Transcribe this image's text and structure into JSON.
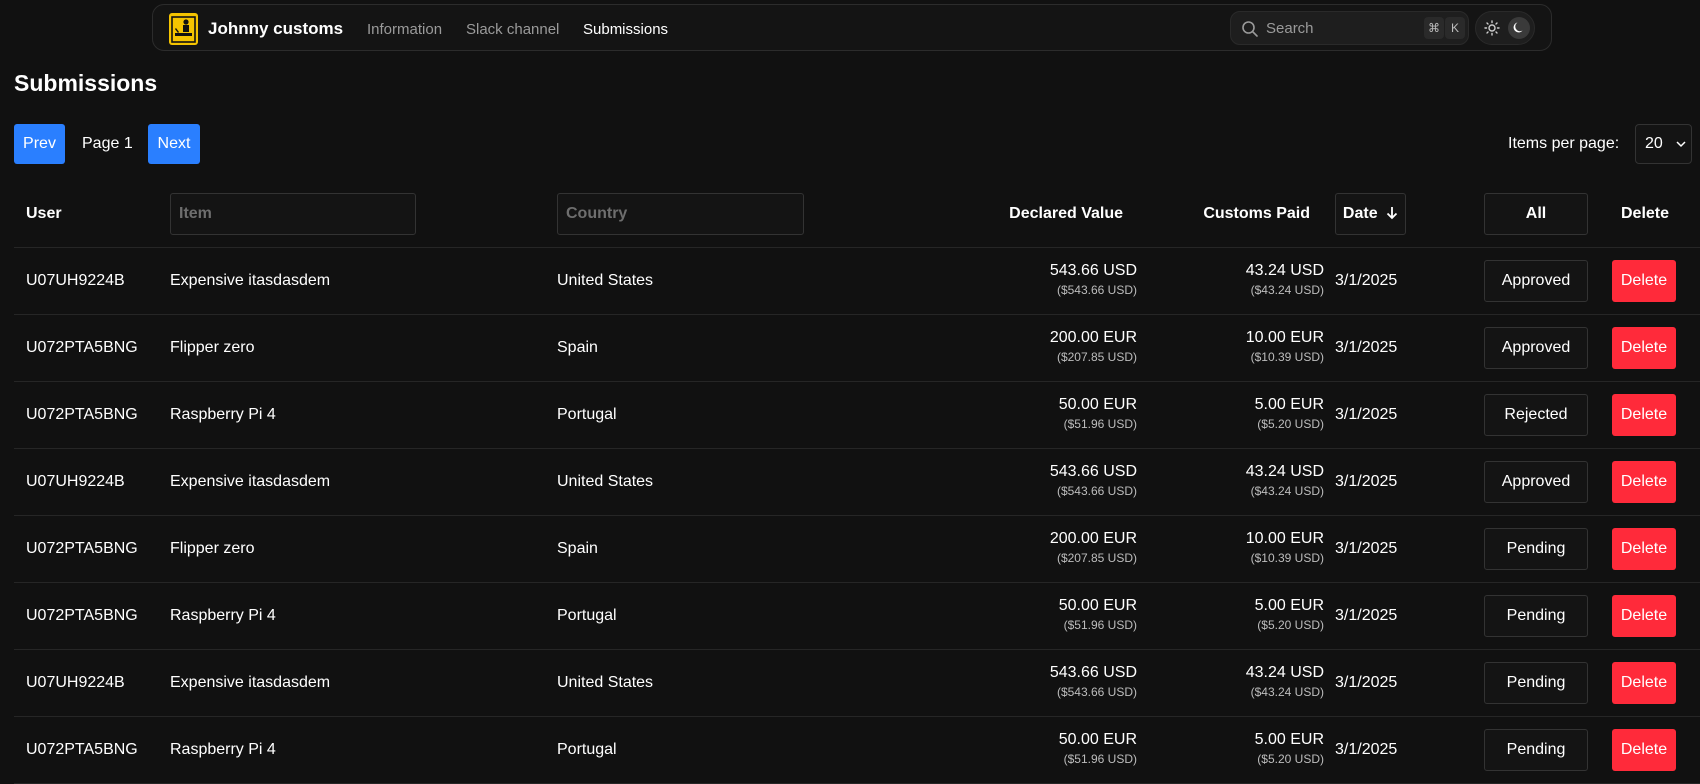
{
  "nav": {
    "brand": "Johnny customs",
    "links": [
      "Information",
      "Slack channel",
      "Submissions"
    ],
    "active_index": 2,
    "search_placeholder": "Search",
    "kbd_cmd": "⌘",
    "kbd_k": "K",
    "logo_icon": "customs-officer-logo",
    "theme_options": [
      "light",
      "dark"
    ],
    "theme_selected": "dark"
  },
  "page": {
    "title": "Submissions",
    "prev_label": "Prev",
    "page_label": "Page 1",
    "next_label": "Next",
    "items_per_page_label": "Items per page:",
    "items_per_page_value": "20"
  },
  "table": {
    "headers": {
      "user": "User",
      "item_placeholder": "Item",
      "country_placeholder": "Country",
      "declared_value": "Declared Value",
      "customs_paid": "Customs Paid",
      "date": "Date",
      "status_filter": "All",
      "delete": "Delete"
    },
    "rows": [
      {
        "user": "U07UH9224B",
        "item": "Expensive itasdasdem",
        "country": "United States",
        "declared": "543.66 USD",
        "declared_usd": "($543.66 USD)",
        "paid": "43.24 USD",
        "paid_usd": "($43.24 USD)",
        "date": "3/1/2025",
        "status": "Approved",
        "delete": "Delete"
      },
      {
        "user": "U072PTA5BNG",
        "item": "Flipper zero",
        "country": "Spain",
        "declared": "200.00 EUR",
        "declared_usd": "($207.85 USD)",
        "paid": "10.00 EUR",
        "paid_usd": "($10.39 USD)",
        "date": "3/1/2025",
        "status": "Approved",
        "delete": "Delete"
      },
      {
        "user": "U072PTA5BNG",
        "item": "Raspberry Pi 4",
        "country": "Portugal",
        "declared": "50.00 EUR",
        "declared_usd": "($51.96 USD)",
        "paid": "5.00 EUR",
        "paid_usd": "($5.20 USD)",
        "date": "3/1/2025",
        "status": "Rejected",
        "delete": "Delete"
      },
      {
        "user": "U07UH9224B",
        "item": "Expensive itasdasdem",
        "country": "United States",
        "declared": "543.66 USD",
        "declared_usd": "($543.66 USD)",
        "paid": "43.24 USD",
        "paid_usd": "($43.24 USD)",
        "date": "3/1/2025",
        "status": "Approved",
        "delete": "Delete"
      },
      {
        "user": "U072PTA5BNG",
        "item": "Flipper zero",
        "country": "Spain",
        "declared": "200.00 EUR",
        "declared_usd": "($207.85 USD)",
        "paid": "10.00 EUR",
        "paid_usd": "($10.39 USD)",
        "date": "3/1/2025",
        "status": "Pending",
        "delete": "Delete"
      },
      {
        "user": "U072PTA5BNG",
        "item": "Raspberry Pi 4",
        "country": "Portugal",
        "declared": "50.00 EUR",
        "declared_usd": "($51.96 USD)",
        "paid": "5.00 EUR",
        "paid_usd": "($5.20 USD)",
        "date": "3/1/2025",
        "status": "Pending",
        "delete": "Delete"
      },
      {
        "user": "U07UH9224B",
        "item": "Expensive itasdasdem",
        "country": "United States",
        "declared": "543.66 USD",
        "declared_usd": "($543.66 USD)",
        "paid": "43.24 USD",
        "paid_usd": "($43.24 USD)",
        "date": "3/1/2025",
        "status": "Pending",
        "delete": "Delete"
      },
      {
        "user": "U072PTA5BNG",
        "item": "Raspberry Pi 4",
        "country": "Portugal",
        "declared": "50.00 EUR",
        "declared_usd": "($51.96 USD)",
        "paid": "5.00 EUR",
        "paid_usd": "($5.20 USD)",
        "date": "3/1/2025",
        "status": "Pending",
        "delete": "Delete"
      }
    ]
  },
  "colors": {
    "background": "#111111",
    "primary_button": "#2a7fff",
    "delete_button": "#ff2a3a",
    "logo_yellow": "#f5c400"
  }
}
